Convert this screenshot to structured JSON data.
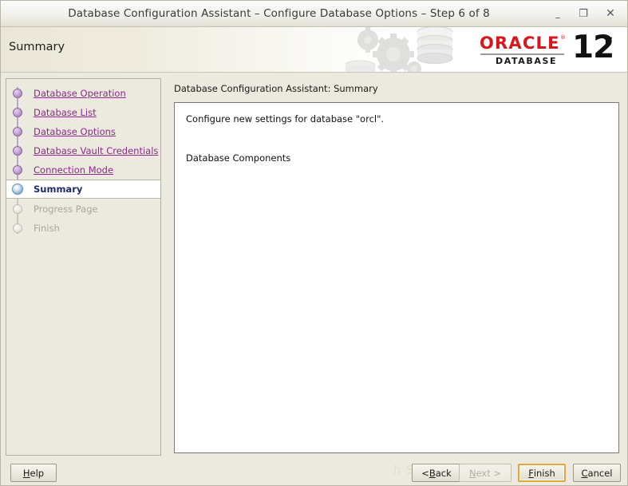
{
  "window": {
    "title": "Database Configuration Assistant – Configure Database Options – Step 6 of 8",
    "controls": {
      "minimize": "–",
      "maximize": "❐",
      "close": "✕"
    }
  },
  "banner": {
    "title": "Summary",
    "logo": {
      "brand": "ORACLE",
      "trademark": "®",
      "product": "DATABASE",
      "version": "12",
      "edition": "c"
    },
    "accent_red": "#d8161c"
  },
  "sidebar": {
    "items": [
      {
        "label": "Database Operation",
        "state": "done"
      },
      {
        "label": "Database List",
        "state": "done"
      },
      {
        "label": "Database Options",
        "state": "done"
      },
      {
        "label": "Database Vault Credentials",
        "state": "done"
      },
      {
        "label": "Connection Mode",
        "state": "done"
      },
      {
        "label": "Summary",
        "state": "current"
      },
      {
        "label": "Progress Page",
        "state": "pending"
      },
      {
        "label": "Finish",
        "state": "pending"
      }
    ]
  },
  "content": {
    "label": "Database Configuration Assistant: Summary",
    "line1": "Configure new settings for database \"orcl\".",
    "heading": "Database Components"
  },
  "footer": {
    "help": {
      "pre": "",
      "mnemonic": "H",
      "post": "elp"
    },
    "back": {
      "pre": "< ",
      "mnemonic": "B",
      "post": "ack"
    },
    "next": {
      "pre": "",
      "mnemonic": "N",
      "post": "ext >"
    },
    "finish": {
      "pre": "",
      "mnemonic": "F",
      "post": "inish"
    },
    "cancel": {
      "pre": "",
      "mnemonic": "C",
      "post": "ancel"
    },
    "watermark": "h                  SSL                R   N"
  },
  "colors": {
    "chrome": "#ece9de",
    "link": "#8b2a8b",
    "current_text": "#1b2b6b",
    "focus_ring": "#e0a93a"
  }
}
